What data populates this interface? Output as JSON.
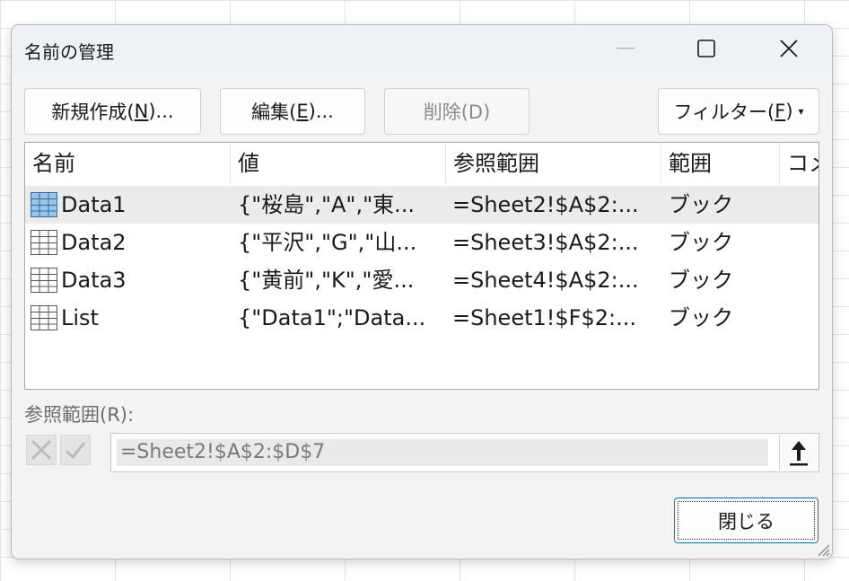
{
  "dialog": {
    "title": "名前の管理",
    "controls": {
      "minimize_icon": "minimize-icon",
      "maximize_icon": "maximize-icon",
      "close_icon": "close-icon"
    }
  },
  "toolbar": {
    "new_label": "新規作成(",
    "new_key": "N",
    "new_suffix": ")...",
    "edit_label": "編集(",
    "edit_key": "E",
    "edit_suffix": ")...",
    "delete_label": "削除(D)",
    "filter_label": "フィルター(",
    "filter_key": "F",
    "filter_suffix": ")",
    "filter_arrow": "▾"
  },
  "table": {
    "columns": [
      "名前",
      "値",
      "参照範囲",
      "範囲",
      "コメント"
    ],
    "rows": [
      {
        "name": "Data1",
        "value": "{\"桜島\",\"A\",\"東...",
        "ref": "=Sheet2!$A$2:...",
        "scope": "ブック",
        "selected": true
      },
      {
        "name": "Data2",
        "value": "{\"平沢\",\"G\",\"山...",
        "ref": "=Sheet3!$A$2:...",
        "scope": "ブック",
        "selected": false
      },
      {
        "name": "Data3",
        "value": "{\"黄前\",\"K\",\"愛...",
        "ref": "=Sheet4!$A$2:...",
        "scope": "ブック",
        "selected": false
      },
      {
        "name": "List",
        "value": "{\"Data1\";\"Data...",
        "ref": "=Sheet1!$F$2:...",
        "scope": "ブック",
        "selected": false
      }
    ]
  },
  "refers_to": {
    "label": "参照範囲(R):",
    "value": "=Sheet2!$A$2:$D$7"
  },
  "footer": {
    "close_label": "閉じる"
  },
  "colors": {
    "selected_row": "#ebebeb",
    "title_bar": "#eef1f6",
    "selected_icon": "#5b9bd5"
  }
}
